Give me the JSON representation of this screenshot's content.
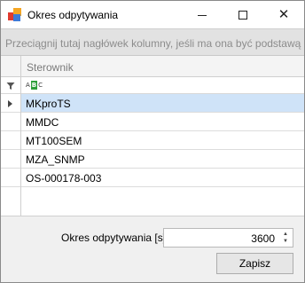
{
  "window": {
    "title": "Okres odpytywania"
  },
  "group_panel": {
    "hint": "Przeciągnij tutaj nagłówek kolumny, jeśli ma ona być podstawą grupc"
  },
  "grid": {
    "column_header": "Sterownik",
    "filter_icon": "filter-icon",
    "filter_mode_icon": "abc-text-filter-icon",
    "rows": [
      {
        "name": "MKproTS",
        "selected": true
      },
      {
        "name": "MMDC",
        "selected": false
      },
      {
        "name": "MT100SEM",
        "selected": false
      },
      {
        "name": "MZA_SNMP",
        "selected": false
      },
      {
        "name": "OS-000178-003",
        "selected": false
      }
    ]
  },
  "form": {
    "period_label": "Okres odpytywania [s]",
    "period_value": "3600",
    "save_label": "Zapisz"
  },
  "colors": {
    "selected_row": "#cfe3f8",
    "group_panel_bg": "#e2e2e2"
  }
}
